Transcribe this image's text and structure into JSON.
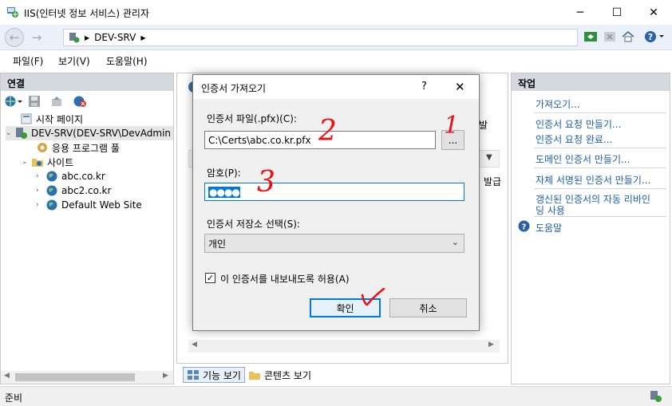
{
  "window": {
    "title": "IIS(인터넷 정보 서비스) 관리자",
    "minimize": "─",
    "maximize": "☐",
    "close": "✕"
  },
  "address": {
    "path": "DEV-SRV"
  },
  "menu": [
    "파일(F)",
    "보기(V)",
    "도움말(H)"
  ],
  "connections": {
    "header": "연결",
    "tree": {
      "start_page": "시작 페이지",
      "server": "DEV-SRV(DEV-SRV\\DevAdmin",
      "app_pools": "응용 프로그램 풀",
      "sites": "사이트",
      "site_list": [
        "abc.co.kr",
        "abc2.co.kr",
        "Default Web Site"
      ]
    }
  },
  "middle": {
    "partial_text_1": "발",
    "partial_text_2": "발급",
    "tabs": [
      "기능 보기",
      "콘텐츠 보기"
    ]
  },
  "actions": {
    "header": "작업",
    "items": [
      "가져오기...",
      "인증서 요청 만들기...",
      "인증서 요청 완료...",
      "도메인 인증서 만들기...",
      "자체 서명된 인증서 만들기...",
      "갱신된 인증서의 자동 리바인",
      "딩 사용",
      "도움말"
    ]
  },
  "status": {
    "text": "준비"
  },
  "dialog": {
    "title": "인증서 가져오기",
    "help": "?",
    "close": "✕",
    "file_label": "인증서 파일(.pfx)(C):",
    "file_value": "C:\\Certs\\abc.co.kr.pfx",
    "browse_label": "...",
    "password_label": "암호(P):",
    "password_masked": "●●●●",
    "store_label": "인증서 저장소 선택(S):",
    "store_value": "개인",
    "export_checkbox_label": "이 인증서를 내보내도록 허용(A)",
    "export_checked": true,
    "ok_label": "확인",
    "cancel_label": "취소"
  },
  "annotations": [
    "1",
    "2",
    "3"
  ],
  "colors": {
    "accent": "#0078d7",
    "link": "#1e5fa8",
    "panel_header": "#d4d9e0",
    "annotation": "#ee1111"
  }
}
